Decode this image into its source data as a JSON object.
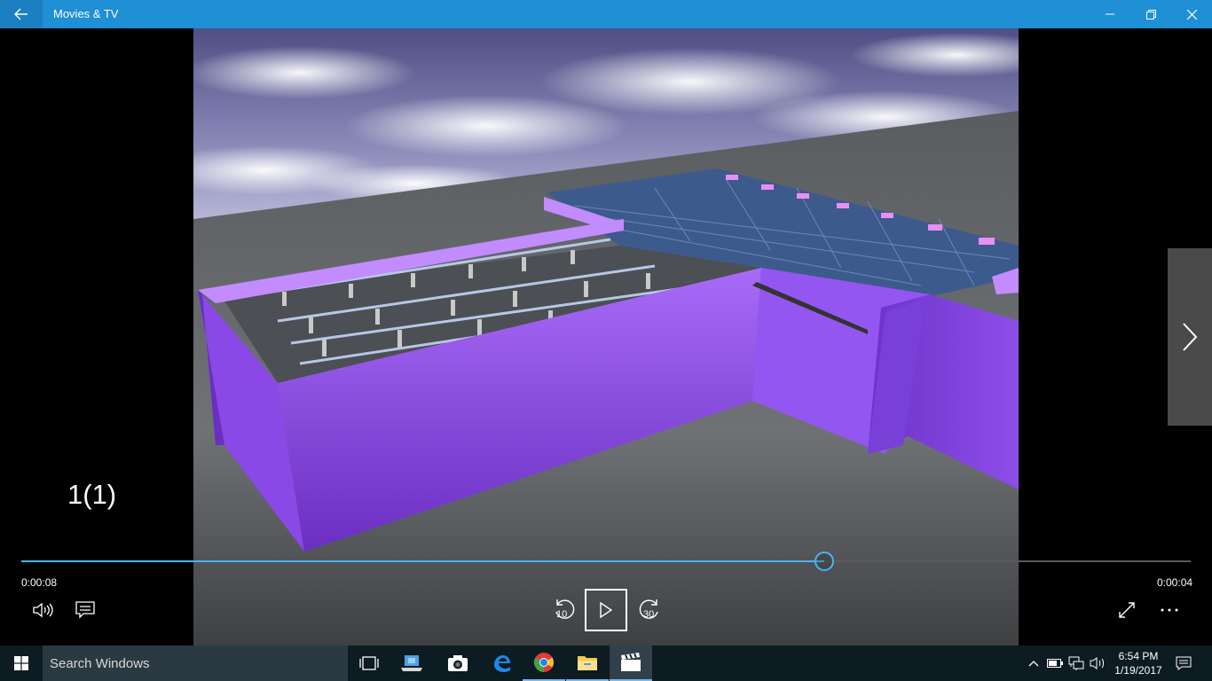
{
  "window": {
    "title": "Movies & TV"
  },
  "player": {
    "video_name": "1(1)",
    "elapsed": "0:00:08",
    "remaining": "0:00:04",
    "progress": 0.687,
    "skip_back_seconds": "10",
    "skip_forward_seconds": "30"
  },
  "taskbar": {
    "search_placeholder": "Search Windows",
    "time": "6:54 PM",
    "date": "1/19/2017"
  },
  "colors": {
    "titlebar": "#1f8fd6",
    "accent": "#4ab3f2",
    "wall": "#9a5cf0",
    "sky": "#6e6ea0"
  },
  "icons": {
    "back": "arrow-left-icon",
    "minimize": "minimize-icon",
    "restore": "restore-icon",
    "close": "close-icon",
    "next": "chevron-right-icon",
    "volume": "volume-icon",
    "captions": "captions-icon",
    "skip_back": "skip-back-icon",
    "play": "play-icon",
    "skip_forward": "skip-forward-icon",
    "fullscreen": "fullscreen-icon",
    "more": "more-icon"
  }
}
